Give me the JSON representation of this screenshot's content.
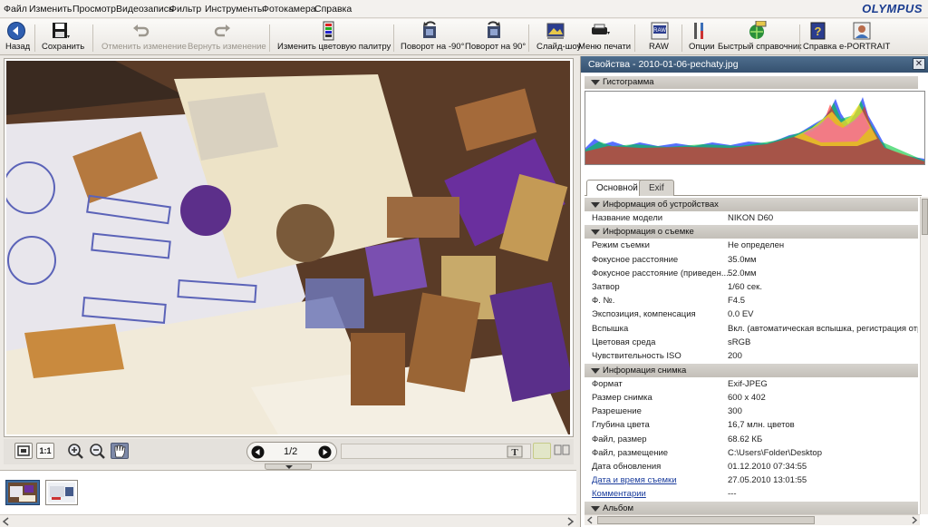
{
  "menu": {
    "items": [
      "Файл",
      "Изменить",
      "Просмотр",
      "Видеозапись",
      "Фильтр",
      "Инструменты",
      "Фотокамера",
      "Справка"
    ],
    "brand": "OLYMPUS"
  },
  "toolbar": {
    "back": "Назад",
    "save": "Сохранить",
    "undo": "Отменить изменение",
    "redo": "Вернуть изменение",
    "palette": "Изменить цветовую палитру",
    "rot_left": "Поворот на -90°",
    "rot_right": "Поворот на 90°",
    "slideshow": "Слайд-шоу",
    "print_menu": "Меню печати",
    "raw": "RAW",
    "options": "Опции",
    "quick_ref": "Быстрый справочник",
    "help": "Справка",
    "eportrait": "e-PORTRAIT"
  },
  "viewer": {
    "page_indicator": "1/2",
    "fit_icon": "fit-window-icon",
    "actual_size": "1:1"
  },
  "props": {
    "title": "Свойства - 2010-01-06-pechaty.jpg",
    "histogram_header": "Гистограмма",
    "tabs": [
      "Основной",
      "Exif"
    ],
    "sections": {
      "device": "Информация об устройствах",
      "shooting": "Информация о съемке",
      "image": "Информация снимка",
      "album": "Альбом"
    },
    "device_rows": [
      {
        "k": "Название модели",
        "v": "NIKON D60"
      }
    ],
    "shooting_rows": [
      {
        "k": "Режим съемки",
        "v": "Не определен"
      },
      {
        "k": "Фокусное расстояние",
        "v": "35.0мм"
      },
      {
        "k": "Фокусное расстояние (приведен...",
        "v": "52.0мм"
      },
      {
        "k": "Затвор",
        "v": "1/60 сек."
      },
      {
        "k": "Ф. №.",
        "v": "F4.5"
      },
      {
        "k": "Экспозиция, компенсация",
        "v": "0.0 EV"
      },
      {
        "k": "Вспышка",
        "v": "Вкл. (автоматическая вспышка, регистрация отраж"
      },
      {
        "k": "Цветовая среда",
        "v": "sRGB"
      },
      {
        "k": "Чувствительность ISO",
        "v": "200"
      }
    ],
    "image_rows": [
      {
        "k": "Формат",
        "v": "Exif-JPEG"
      },
      {
        "k": "Размер снимка",
        "v": "600 x 402"
      },
      {
        "k": "Разрешение",
        "v": "300"
      },
      {
        "k": "Глубина цвета",
        "v": "16,7 млн. цветов"
      },
      {
        "k": "Файл, размер",
        "v": "68.62 КБ"
      },
      {
        "k": "Файл, размещение",
        "v": "C:\\Users\\Folder\\Desktop"
      },
      {
        "k": "Дата обновления",
        "v": "01.12.2010 07:34:55"
      }
    ],
    "link_rows": [
      {
        "k": "Дата и время съемки",
        "v": "27.05.2010 13:01:55"
      },
      {
        "k": "Комментарии",
        "v": "---"
      }
    ]
  },
  "colors": {
    "title_bar": "#3f5f80",
    "accent": "#1a3c8f",
    "link": "#1a3c9c"
  }
}
